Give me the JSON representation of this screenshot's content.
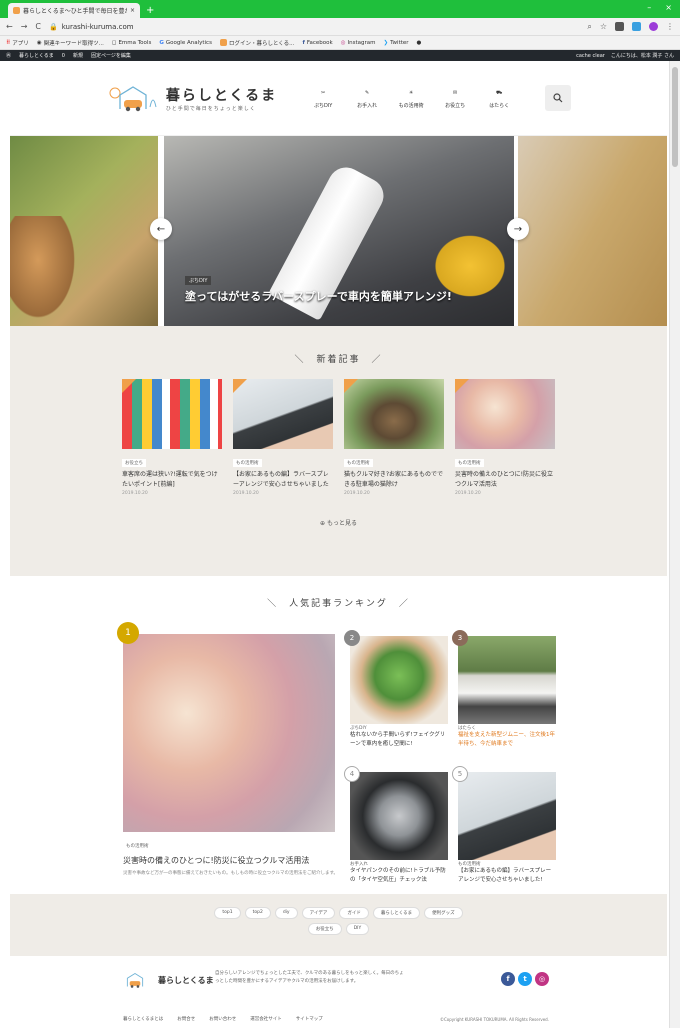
{
  "browser": {
    "tab_title": "暮らしとくるま〜ひと手間で毎日を豊かに〜",
    "url": "kurashi-kurumа.com",
    "bookmarks": [
      "アプリ",
      "関連キーワード取得ツ...",
      "Emma Tools",
      "Google Analytics",
      "ログイン・暮らしとくる...",
      "Facebook",
      "Instagram",
      "Twitter"
    ]
  },
  "adminbar": {
    "items": [
      "暮らしとくるま",
      "0",
      "新規",
      "固定ページを編集"
    ],
    "right": [
      "cache clear",
      "こんにちは、松本 潤子 さん"
    ]
  },
  "header": {
    "logo_title": "暮らしとくるま",
    "logo_sub": "ひと手間で毎日をちょっと楽しく",
    "nav": [
      "ぷちDIY",
      "お手入れ",
      "もの活用術",
      "お役立ち",
      "はたらく"
    ]
  },
  "hero": {
    "badge": "ぷちDIY",
    "title": "塗ってはがせるラバースプレーで車内を簡単アレンジ!",
    "can_text": "EASY RUBBER SPRAY"
  },
  "new_articles": {
    "heading": "新着記事",
    "cards": [
      {
        "category": "お役立ち",
        "title": "車客席の運は狭い?!運転で気をつけたいポイント[前編]",
        "date": "2019.10.20"
      },
      {
        "category": "もの活用術",
        "title": "【お家にあるもの編】ラバースプレーアレンジで安心させちゃいました",
        "date": "2019.10.20"
      },
      {
        "category": "もの活用術",
        "title": "猫もクルマ好き?お家にあるものでできる駐車場の猫除け",
        "date": "2019.10.20"
      },
      {
        "category": "もの活用術",
        "title": "災害時の備えのひとつに!防災に役立つクルマ活用法",
        "date": "2019.10.20"
      }
    ],
    "more": "もっと見る"
  },
  "ranking": {
    "heading": "人気記事ランキング",
    "first": {
      "num": "1",
      "category": "もの活用術",
      "title": "災害時の備えのひとつに!防災に役立つクルマ活用法",
      "excerpt": "災害や事故など万が一の事態に備えておきたいもの。もしもの時に役立つクルマの活用法をご紹介します。"
    },
    "items": [
      {
        "num": "2",
        "category": "ぷちDIY",
        "title": "枯れないから手間いらず!フェイクグリーンで車内を癒し空間に!"
      },
      {
        "num": "3",
        "category": "はたらく",
        "title": "福祉を支えた新型ジムニー、注文後1年半待ち、今だ納車まで"
      },
      {
        "num": "4",
        "category": "お手入れ",
        "title": "タイヤパンクのその前に!トラブル予防の「タイヤ空気圧」チェック法"
      },
      {
        "num": "5",
        "category": "もの活用術",
        "title": "【お家にあるもの編】ラバースプレーアレンジで安心させちゃいました!"
      }
    ]
  },
  "tags": [
    "top1",
    "top2",
    "diy",
    "アイデア",
    "ガイド",
    "暮らしとくるま",
    "便利グッズ",
    "お役立ち",
    "DIY"
  ],
  "footer": {
    "logo_title": "暮らしとくるま",
    "desc": "自分らしいアレンジでちょっとした工夫で、クルマのある暮らしをもっと楽しく。毎日のちょっとした時間を豊かにするアイデアやクルマの活用法をお届けします。",
    "links": [
      "暮らしとくるまとは",
      "お問合せ",
      "お問い合わせ",
      "運営会社サイト",
      "サイトマップ"
    ],
    "copyright": "©Copyright KURASHI TOKURUMA. All Rights Reserved."
  },
  "colors": {
    "accent": "#f0a04a",
    "chrome_green": "#1fbf3c",
    "section_bg": "#efece7",
    "gold": "#d4a800",
    "silver": "#888888",
    "bronze": "#8b6b5a"
  }
}
